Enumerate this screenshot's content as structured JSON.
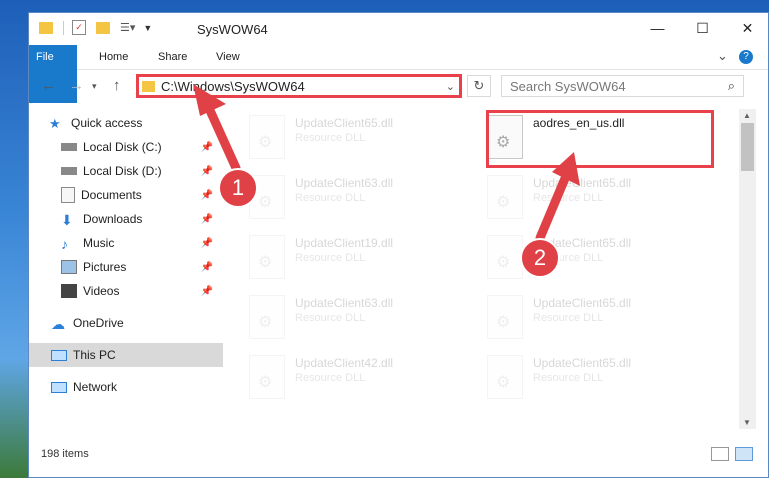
{
  "window": {
    "title": "SysWOW64",
    "minimize": "—",
    "maximize": "☐",
    "close": "✕"
  },
  "ribbon": {
    "tabs": [
      "File",
      "Home",
      "Share",
      "View"
    ],
    "expand": "⌄",
    "help": "?"
  },
  "address": {
    "path": "C:\\Windows\\SysWOW64",
    "search_placeholder": "Search SysWOW64"
  },
  "nav_pane": {
    "quick_access": "Quick access",
    "items": [
      {
        "label": "Local Disk (C:)",
        "pinned": true
      },
      {
        "label": "Local Disk (D:)",
        "pinned": true
      },
      {
        "label": "Documents",
        "pinned": true
      },
      {
        "label": "Downloads",
        "pinned": true
      },
      {
        "label": "Music",
        "pinned": true
      },
      {
        "label": "Pictures",
        "pinned": true
      },
      {
        "label": "Videos",
        "pinned": true
      }
    ],
    "onedrive": "OneDrive",
    "this_pc": "This PC",
    "network": "Network"
  },
  "files": {
    "highlighted": {
      "name": "aodres_en_us.dll",
      "type": ""
    },
    "left": [
      {
        "name": "UpdateClient65.dll",
        "type": "Resource DLL"
      },
      {
        "name": "UpdateClient63.dll",
        "type": "Resource DLL"
      },
      {
        "name": "UpdateClient19.dll",
        "type": "Resource DLL"
      },
      {
        "name": "UpdateClient63.dll",
        "type": "Resource DLL"
      },
      {
        "name": "UpdateClient42.dll",
        "type": "Resource DLL"
      }
    ],
    "right": [
      {
        "name": "UpdateClient65.dll",
        "type": "Resource DLL"
      },
      {
        "name": "UpdateClient65.dll",
        "type": "Resource DLL"
      },
      {
        "name": "UpdateClient65.dll",
        "type": "Resource DLL"
      },
      {
        "name": "UpdateClient65.dll",
        "type": "Resource DLL"
      }
    ]
  },
  "status": {
    "item_count": "198 items"
  },
  "annotations": {
    "step1": "1",
    "step2": "2",
    "color": "#e04146"
  }
}
